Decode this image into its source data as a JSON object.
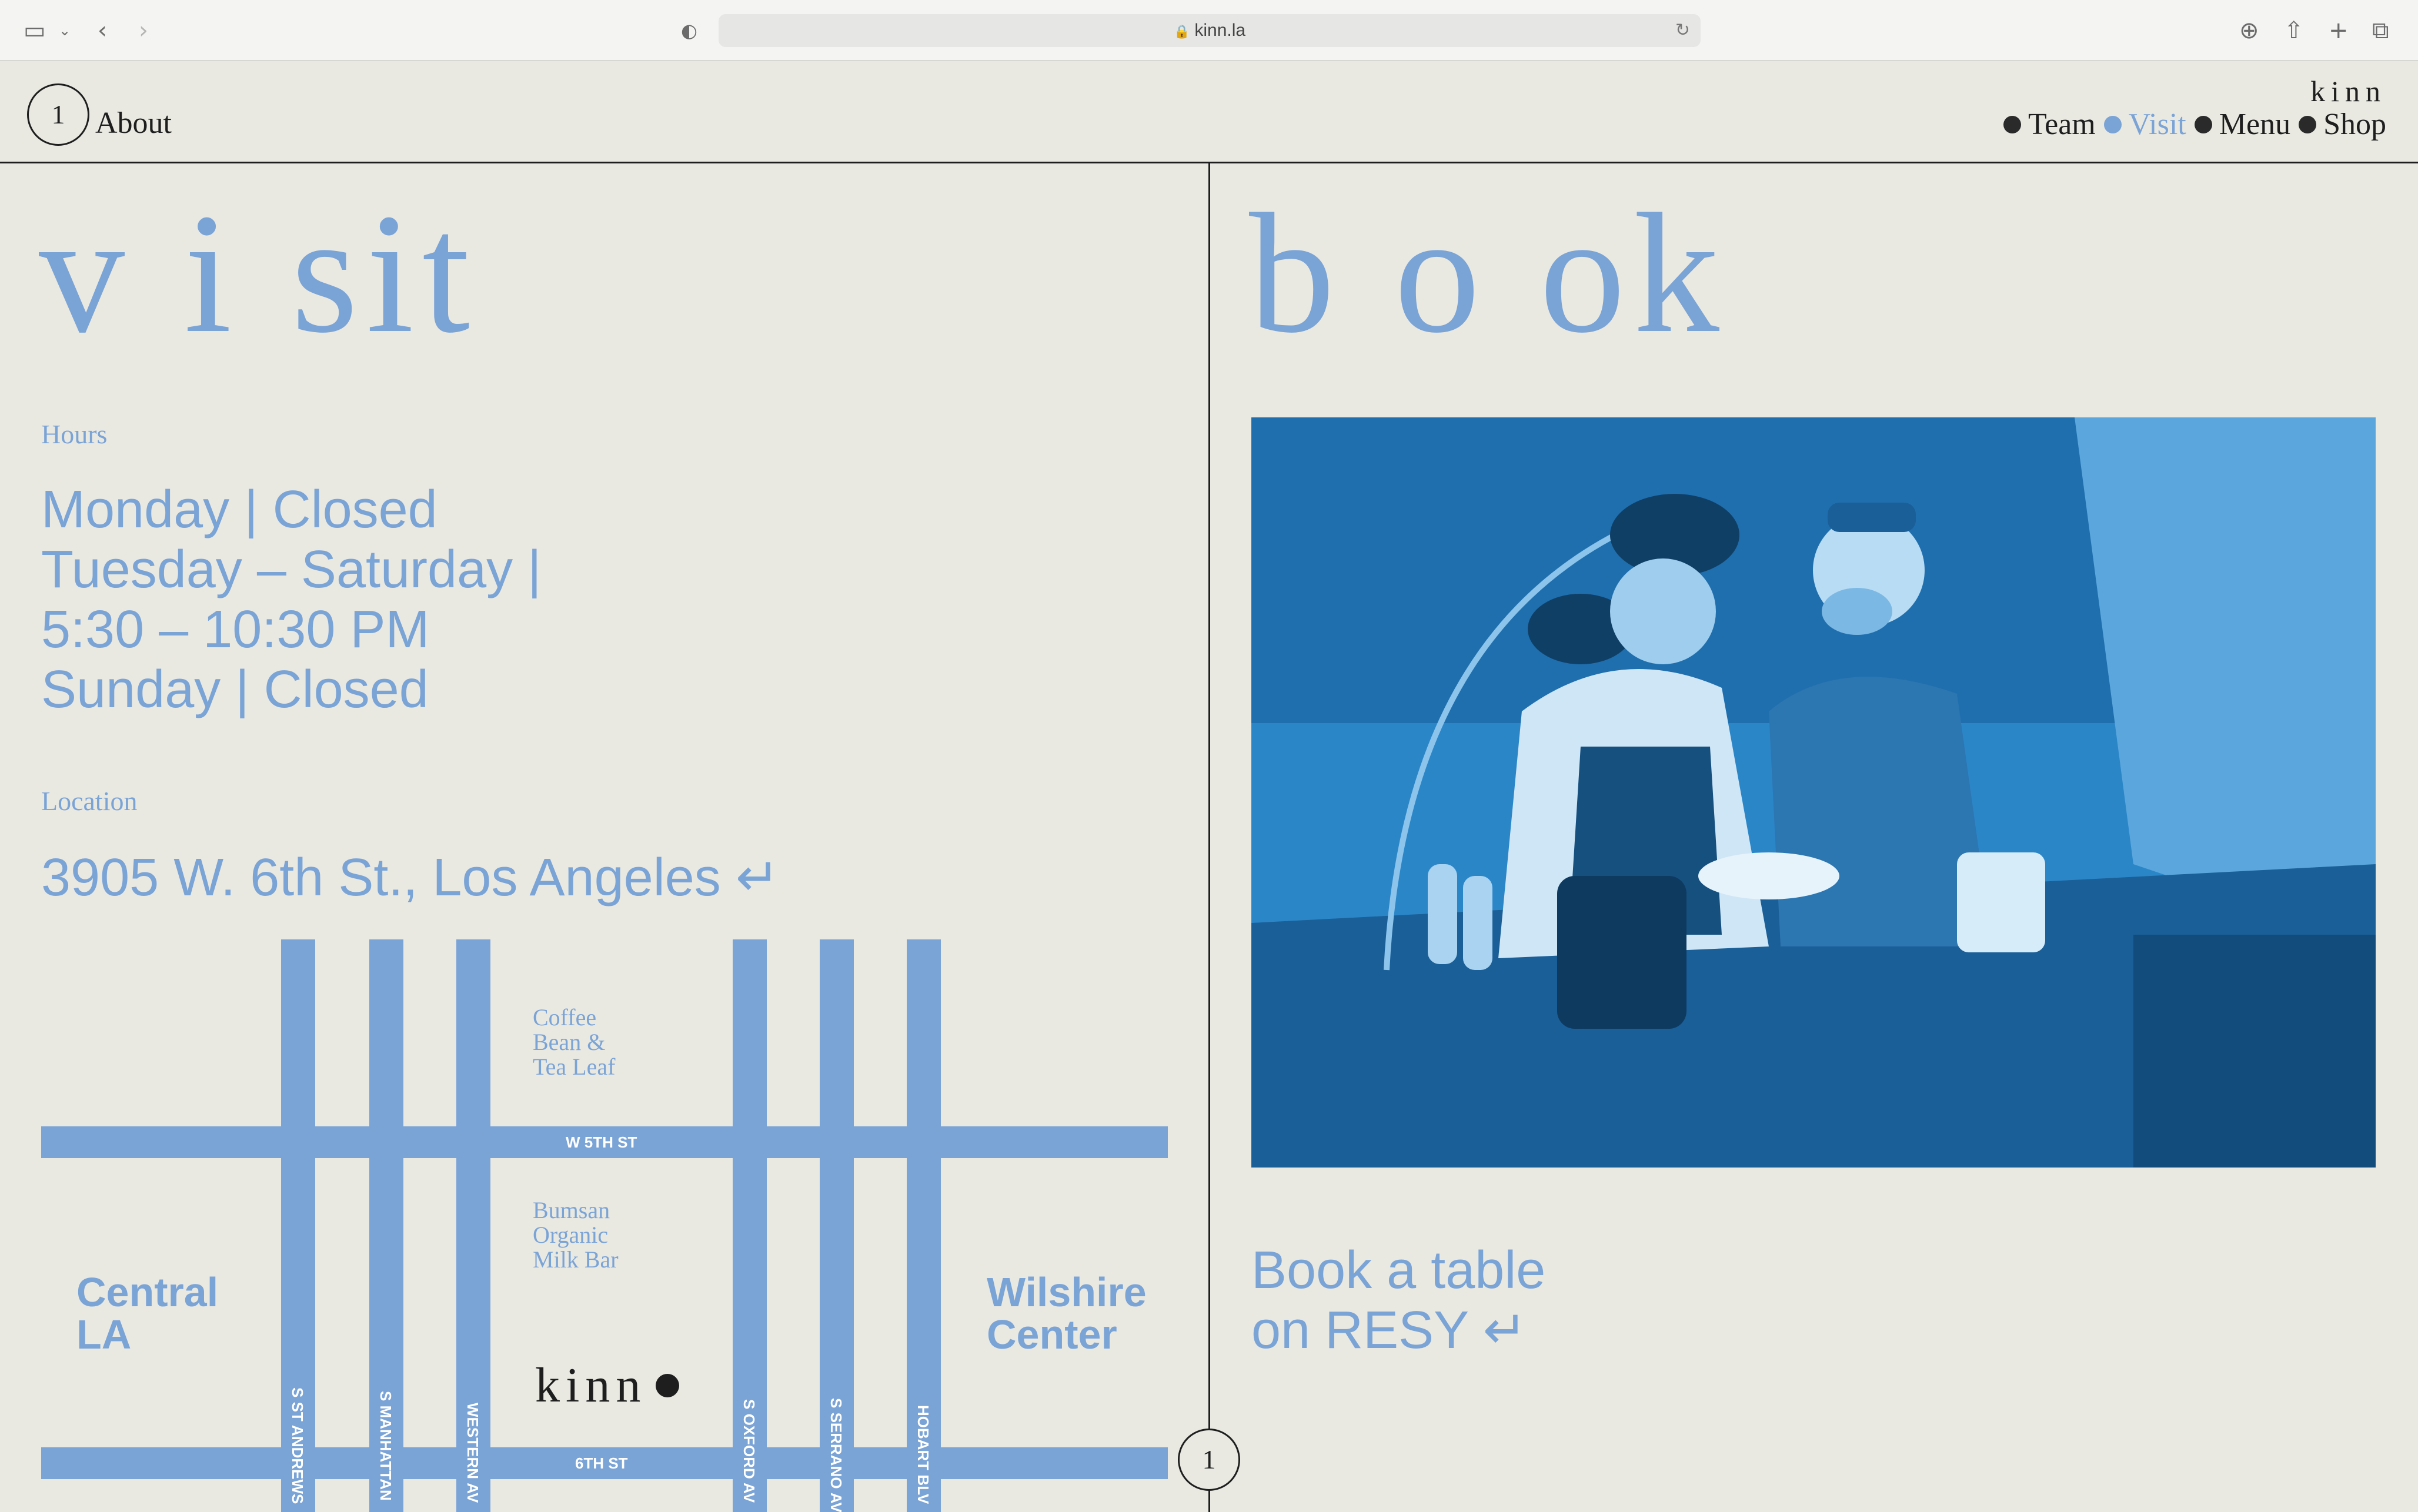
{
  "browser": {
    "url": "kinn.la"
  },
  "header": {
    "page_number": "1",
    "about_label": "About",
    "brand": "kinn",
    "nav": [
      {
        "label": "Team"
      },
      {
        "label": "Visit"
      },
      {
        "label": "Menu"
      },
      {
        "label": "Shop"
      }
    ]
  },
  "visit": {
    "title": "v i sit",
    "hours_label": "Hours",
    "hours": [
      "Monday | Closed",
      "Tuesday – Saturday |",
      "5:30 – 10:30 PM",
      "Sunday | Closed"
    ],
    "location_label": "Location",
    "address": "3905 W. 6th St., Los Angeles ↵",
    "map": {
      "streets_h": [
        "W 5TH ST",
        "6TH ST"
      ],
      "streets_v": [
        "S ST ANDREWS",
        "S MANHATTAN",
        "WESTERN AV",
        "S OXFORD AV",
        "S SERRANO AV",
        "HOBART BLV"
      ],
      "poi_1": [
        "Coffee",
        "Bean &",
        "Tea Leaf"
      ],
      "poi_2": [
        "Bumsan",
        "Organic",
        "Milk Bar"
      ],
      "area_left": [
        "Central",
        "LA"
      ],
      "area_right": [
        "Wilshire",
        "Center"
      ],
      "marker": "kinn"
    }
  },
  "book": {
    "title": "b o ok",
    "cta": [
      "Book a table",
      "on RESY ↵"
    ],
    "page_number": "1"
  },
  "colors": {
    "accent": "#7aa3d6",
    "background": "#e9e9e2",
    "ink": "#1e1e1e",
    "photo_tint": "#2b86c8"
  }
}
